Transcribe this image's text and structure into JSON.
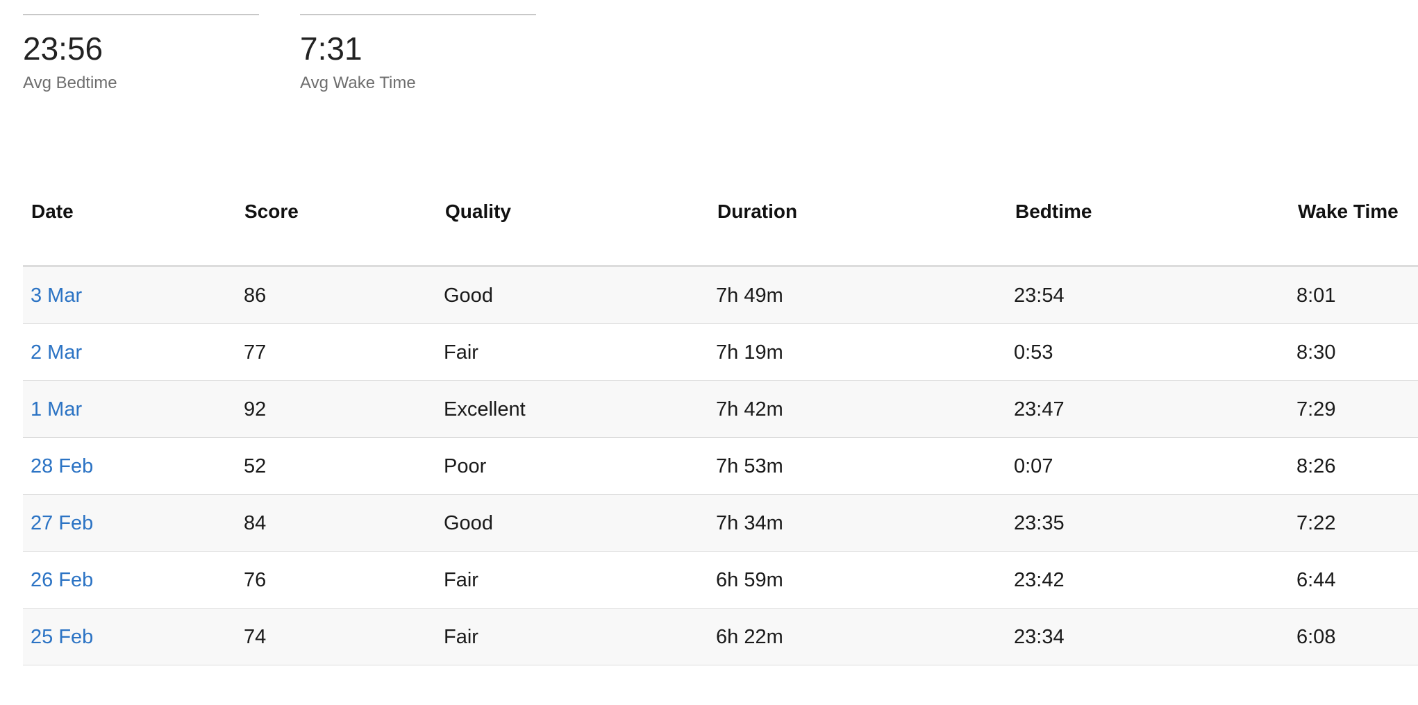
{
  "summary": {
    "avg_bedtime": {
      "value": "23:56",
      "label": "Avg Bedtime"
    },
    "avg_wake_time": {
      "value": "7:31",
      "label": "Avg Wake Time"
    }
  },
  "table": {
    "headers": {
      "date": "Date",
      "score": "Score",
      "quality": "Quality",
      "duration": "Duration",
      "bedtime": "Bedtime",
      "wake_time": "Wake Time"
    },
    "rows": [
      {
        "date": "3 Mar",
        "score": "86",
        "quality": "Good",
        "duration": "7h 49m",
        "bedtime": "23:54",
        "wake_time": "8:01"
      },
      {
        "date": "2 Mar",
        "score": "77",
        "quality": "Fair",
        "duration": "7h 19m",
        "bedtime": "0:53",
        "wake_time": "8:30"
      },
      {
        "date": "1 Mar",
        "score": "92",
        "quality": "Excellent",
        "duration": "7h 42m",
        "bedtime": "23:47",
        "wake_time": "7:29"
      },
      {
        "date": "28 Feb",
        "score": "52",
        "quality": "Poor",
        "duration": "7h 53m",
        "bedtime": "0:07",
        "wake_time": "8:26"
      },
      {
        "date": "27 Feb",
        "score": "84",
        "quality": "Good",
        "duration": "7h 34m",
        "bedtime": "23:35",
        "wake_time": "7:22"
      },
      {
        "date": "26 Feb",
        "score": "76",
        "quality": "Fair",
        "duration": "6h 59m",
        "bedtime": "23:42",
        "wake_time": "6:44"
      },
      {
        "date": "25 Feb",
        "score": "74",
        "quality": "Fair",
        "duration": "6h 22m",
        "bedtime": "23:34",
        "wake_time": "6:08"
      }
    ]
  },
  "colors": {
    "link": "#2b73c4",
    "row_alt_bg": "#f8f8f8",
    "label_gray": "#6e6e6e"
  }
}
